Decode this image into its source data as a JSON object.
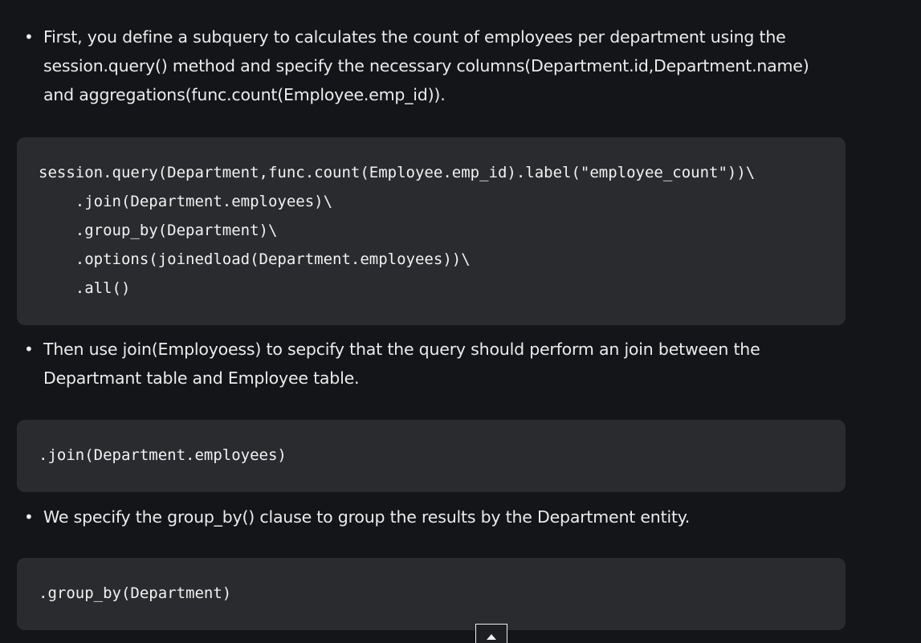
{
  "bullets": [
    {
      "text": "First, you define a subquery to calculates the count of employees per department using the session.query() method and specify the necessary columns(Department.id,Department.name) and aggregations(func.count(Employee.emp_id))."
    },
    {
      "text": "Then use join(Employoess) to sepcify that the query should perform an join between the Departmant table and Employee table."
    },
    {
      "text": "We specify the group_by() clause to group the results by the Department entity."
    }
  ],
  "code_blocks": [
    {
      "lines": [
        "session.query(Department,func.count(Employee.emp_id).label(\"employee_count\"))\\",
        "    .join(Department.employees)\\",
        "    .group_by(Department)\\",
        "    .options(joinedload(Department.employees))\\",
        "    .all()"
      ]
    },
    {
      "lines": [
        ".join(Department.employees)"
      ]
    },
    {
      "lines": [
        ".group_by(Department)"
      ]
    }
  ],
  "scroll_top_icon": "chevron-up-icon"
}
